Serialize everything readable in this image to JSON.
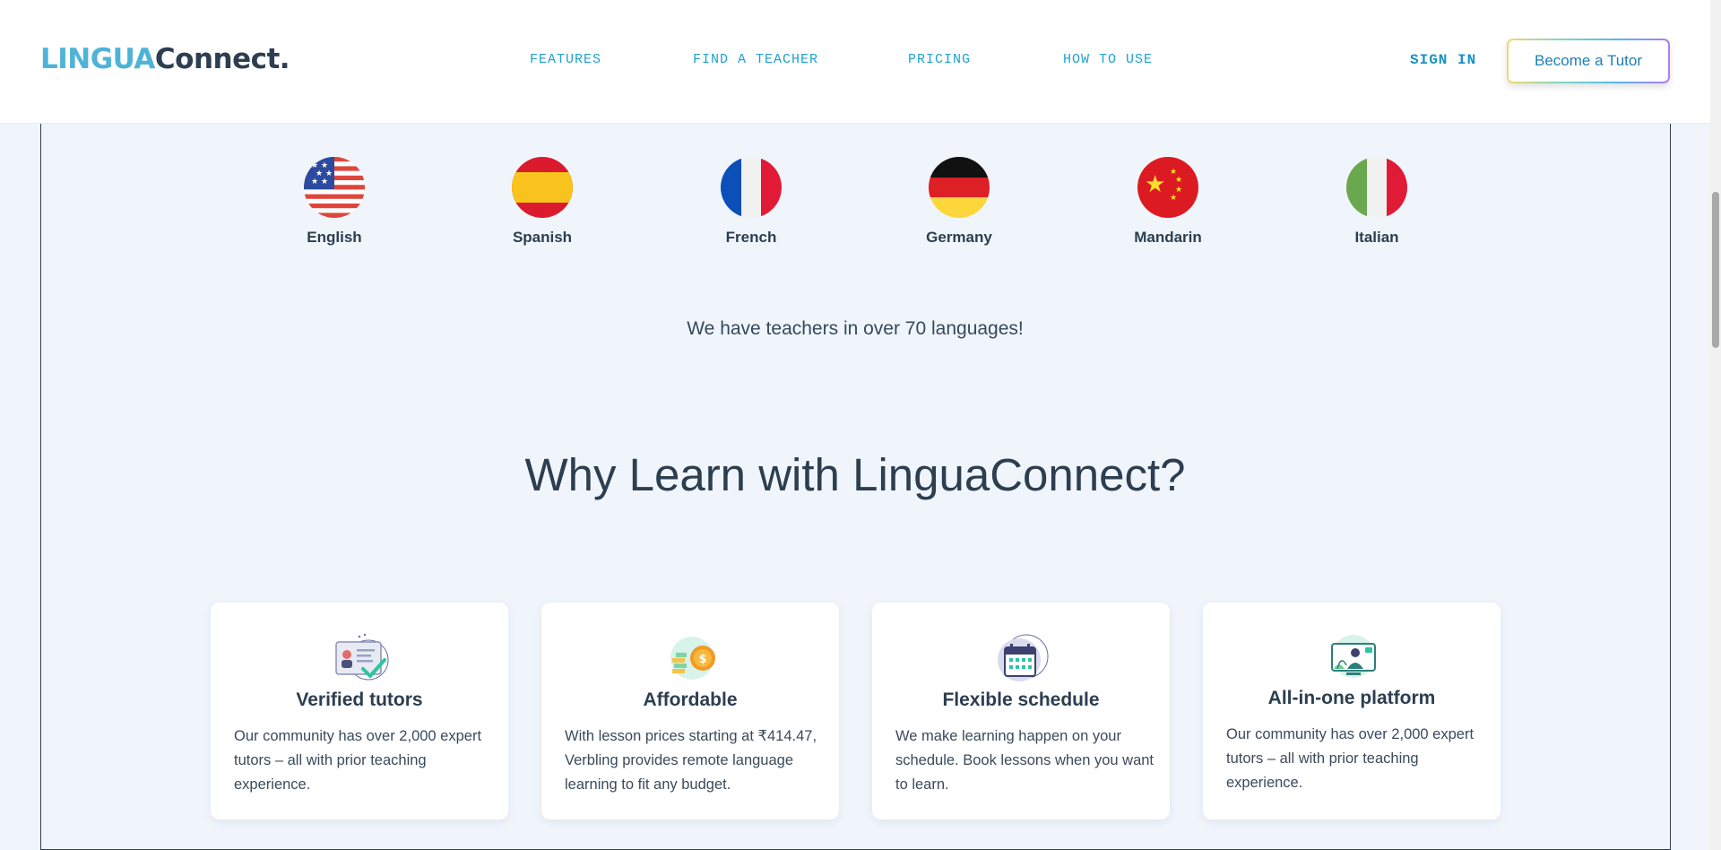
{
  "header": {
    "logo_part1": "LINGUA",
    "logo_part2": "Connect.",
    "nav": [
      "FEATURES",
      "FIND A TEACHER",
      "PRICING",
      "HOW TO USE"
    ],
    "sign_in": "SIGN IN",
    "become_tutor": "Become a Tutor"
  },
  "languages": [
    {
      "name": "English",
      "flag_icon": "us-flag-icon"
    },
    {
      "name": "Spanish",
      "flag_icon": "spain-flag-icon"
    },
    {
      "name": "French",
      "flag_icon": "france-flag-icon"
    },
    {
      "name": "Germany",
      "flag_icon": "germany-flag-icon"
    },
    {
      "name": "Mandarin",
      "flag_icon": "china-flag-icon"
    },
    {
      "name": "Italian",
      "flag_icon": "italy-flag-icon"
    }
  ],
  "teachers_note": "We have teachers in over 70 languages!",
  "why_title": "Why Learn with LinguaConnect?",
  "features": [
    {
      "title": "Verified tutors",
      "text": "Our community has over 2,000 expert tutors – all with prior teaching experience.",
      "icon": "verified-id-card-icon"
    },
    {
      "title": "Affordable",
      "text": "With lesson prices starting at ₹414.47, Verbling provides remote language learning to fit any budget.",
      "icon": "coins-icon"
    },
    {
      "title": "Flexible schedule",
      "text": "We make learning happen on your schedule. Book lessons when you want to learn.",
      "icon": "calendar-icon"
    },
    {
      "title": "All-in-one platform",
      "text": "Our community has over 2,000 expert tutors – all with prior teaching experience.",
      "icon": "video-call-icon"
    }
  ],
  "colors": {
    "accent": "#1fa2cf",
    "logo_light": "#4fb3d8",
    "text_dark": "#2c3e50",
    "page_bg": "#f0f5fb"
  }
}
